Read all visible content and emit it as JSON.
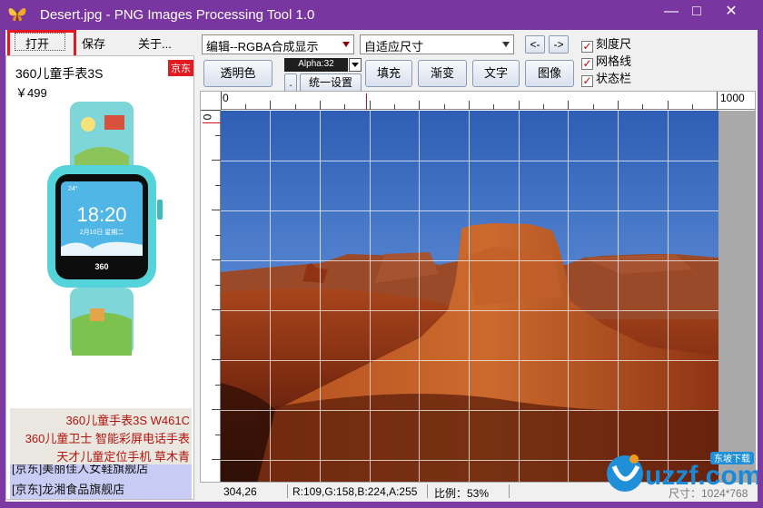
{
  "window": {
    "title": "Desert.jpg - PNG Images Processing Tool 1.0",
    "controls": {
      "minimize": "—",
      "maximize": "□",
      "close": "✕"
    }
  },
  "menu": {
    "open": "打开",
    "save": "保存",
    "about": "关于..."
  },
  "left_panel": {
    "badge": "京东",
    "product_name": "360儿童手表3S",
    "price": "￥499",
    "watch": {
      "time": "18:20",
      "date": "2月10日 星期二",
      "brand": "360",
      "status": "24°"
    },
    "scroll_items": [
      "360儿童手表3S W461C",
      "360儿童卫士 智能彩屏电话手表",
      "天才儿童定位手机 草木青"
    ],
    "list_items": [
      "[京东]美丽佳人女鞋旗舰店",
      "[京东]龙湘食品旗舰店"
    ]
  },
  "toolbar": {
    "mode_select": "编辑--RGBA合成显示",
    "size_select": "自适应尺寸",
    "prev": "<-",
    "next": "->",
    "transparent": "透明色",
    "alpha_label": "Alpha:32",
    "dot": ".",
    "uniform": "统一设置",
    "fill": "填充",
    "gradient": "渐变",
    "text": "文字",
    "image": "图像",
    "checks": {
      "ruler": "刻度尺",
      "grid": "网格线",
      "statusbar": "状态栏"
    }
  },
  "ruler": {
    "h_start": "0",
    "h_end": "1000",
    "v_start": "0"
  },
  "status": {
    "coords": "304,26",
    "pixel": "R:109,G:158,B:224,A:255",
    "scale": "比例：53%",
    "size": "尺寸：1024*768"
  },
  "watermark": {
    "text": "uzzf.com",
    "sub": "东坡下载"
  },
  "colors": {
    "titlebar": "#7a36a0",
    "highlight": "#e8141e",
    "sky": "#3f73c8",
    "rock": "#a6401a"
  }
}
